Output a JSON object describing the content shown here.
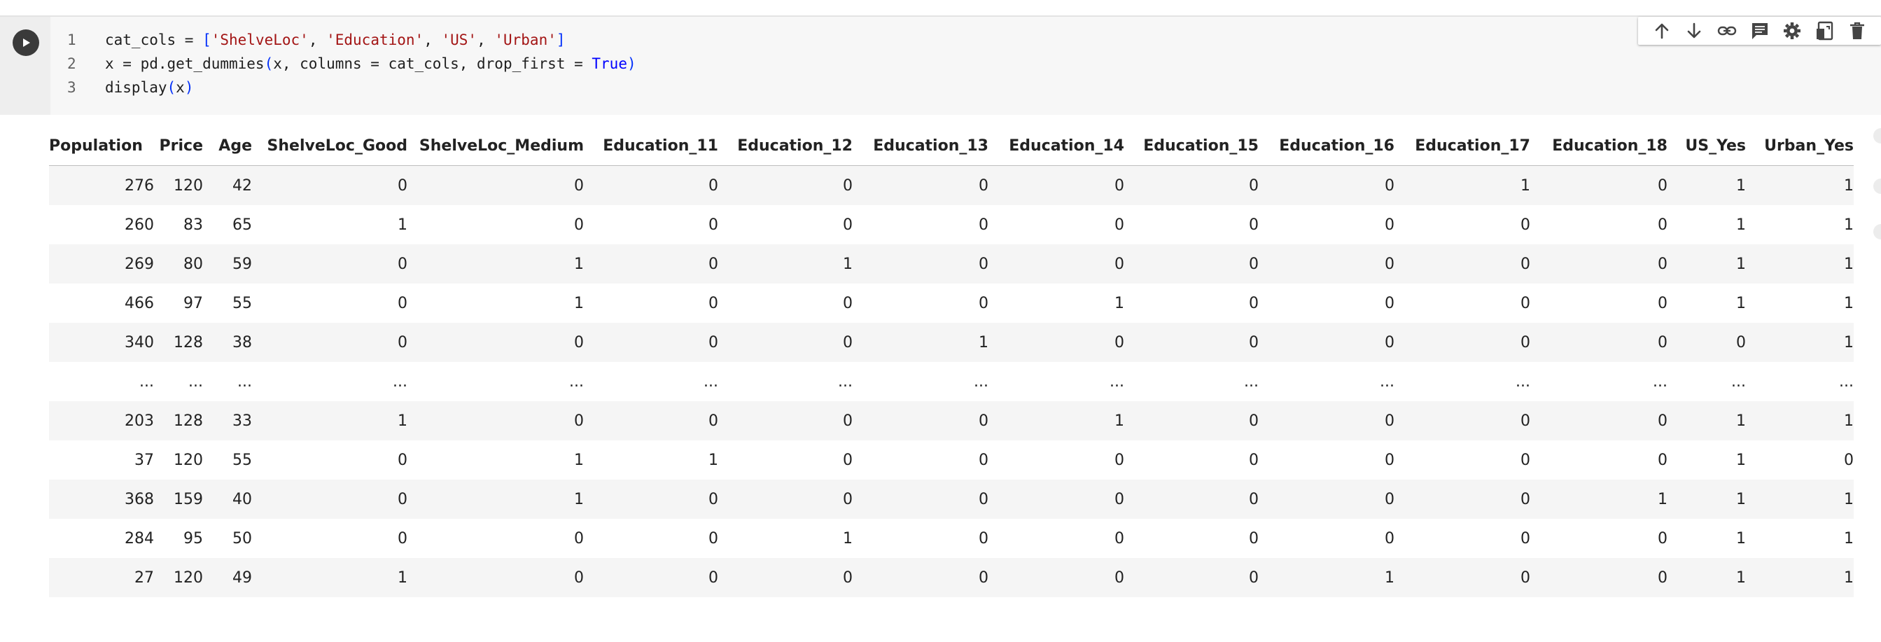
{
  "code_cell": {
    "lines": [
      {
        "num": "1",
        "tokens": [
          {
            "t": "cat_cols = ",
            "c": ""
          },
          {
            "t": "[",
            "c": "brk"
          },
          {
            "t": "'ShelveLoc'",
            "c": "str"
          },
          {
            "t": ", ",
            "c": ""
          },
          {
            "t": "'Education'",
            "c": "str"
          },
          {
            "t": ", ",
            "c": ""
          },
          {
            "t": "'US'",
            "c": "str"
          },
          {
            "t": ", ",
            "c": ""
          },
          {
            "t": "'Urban'",
            "c": "str"
          },
          {
            "t": "]",
            "c": "brk"
          }
        ]
      },
      {
        "num": "2",
        "tokens": [
          {
            "t": "x = pd.get_dummies",
            "c": ""
          },
          {
            "t": "(",
            "c": "brk"
          },
          {
            "t": "x, columns = cat_cols, drop_first = ",
            "c": ""
          },
          {
            "t": "True",
            "c": "kw"
          },
          {
            "t": ")",
            "c": "brk"
          }
        ]
      },
      {
        "num": "3",
        "tokens": [
          {
            "t": "display",
            "c": ""
          },
          {
            "t": "(",
            "c": "brk"
          },
          {
            "t": "x",
            "c": ""
          },
          {
            "t": ")",
            "c": "brk"
          }
        ]
      }
    ]
  },
  "toolbar": {
    "buttons": [
      {
        "name": "move-up-button",
        "icon": "arrow-up-icon"
      },
      {
        "name": "move-down-button",
        "icon": "arrow-down-icon"
      },
      {
        "name": "copy-link-button",
        "icon": "link-icon"
      },
      {
        "name": "add-comment-button",
        "icon": "comment-icon"
      },
      {
        "name": "cell-settings-button",
        "icon": "gear-icon"
      },
      {
        "name": "mirror-cell-button",
        "icon": "mirror-tab-icon"
      },
      {
        "name": "delete-cell-button",
        "icon": "trash-icon"
      }
    ]
  },
  "output_table": {
    "columns": [
      "Population",
      "Price",
      "Age",
      "ShelveLoc_Good",
      "ShelveLoc_Medium",
      "Education_11",
      "Education_12",
      "Education_13",
      "Education_14",
      "Education_15",
      "Education_16",
      "Education_17",
      "Education_18",
      "US_Yes",
      "Urban_Yes"
    ],
    "rows": [
      [
        "276",
        "120",
        "42",
        "0",
        "0",
        "0",
        "0",
        "0",
        "0",
        "0",
        "0",
        "1",
        "0",
        "1",
        "1"
      ],
      [
        "260",
        "83",
        "65",
        "1",
        "0",
        "0",
        "0",
        "0",
        "0",
        "0",
        "0",
        "0",
        "0",
        "1",
        "1"
      ],
      [
        "269",
        "80",
        "59",
        "0",
        "1",
        "0",
        "1",
        "0",
        "0",
        "0",
        "0",
        "0",
        "0",
        "1",
        "1"
      ],
      [
        "466",
        "97",
        "55",
        "0",
        "1",
        "0",
        "0",
        "0",
        "1",
        "0",
        "0",
        "0",
        "0",
        "1",
        "1"
      ],
      [
        "340",
        "128",
        "38",
        "0",
        "0",
        "0",
        "0",
        "1",
        "0",
        "0",
        "0",
        "0",
        "0",
        "0",
        "1"
      ],
      [
        "...",
        "...",
        "...",
        "...",
        "...",
        "...",
        "...",
        "...",
        "...",
        "...",
        "...",
        "...",
        "...",
        "...",
        "..."
      ],
      [
        "203",
        "128",
        "33",
        "1",
        "0",
        "0",
        "0",
        "0",
        "1",
        "0",
        "0",
        "0",
        "0",
        "1",
        "1"
      ],
      [
        "37",
        "120",
        "55",
        "0",
        "1",
        "1",
        "0",
        "0",
        "0",
        "0",
        "0",
        "0",
        "0",
        "1",
        "0"
      ],
      [
        "368",
        "159",
        "40",
        "0",
        "1",
        "0",
        "0",
        "0",
        "0",
        "0",
        "0",
        "0",
        "1",
        "1",
        "1"
      ],
      [
        "284",
        "95",
        "50",
        "0",
        "0",
        "0",
        "1",
        "0",
        "0",
        "0",
        "0",
        "0",
        "0",
        "1",
        "1"
      ],
      [
        "27",
        "120",
        "49",
        "1",
        "0",
        "0",
        "0",
        "0",
        "0",
        "0",
        "1",
        "0",
        "0",
        "1",
        "1"
      ]
    ]
  }
}
